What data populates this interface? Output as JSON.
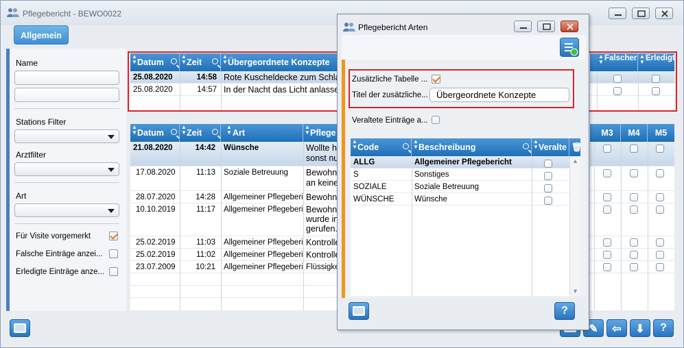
{
  "window": {
    "title": "Pflegebericht - BEWO0022"
  },
  "tabs": {
    "main": "Allgemein"
  },
  "filters": {
    "name_label": "Name",
    "stations_label": "Stations Filter",
    "arzt_label": "Arztfilter",
    "art_label": "Art",
    "visite_label": "Für Visite vorgemerkt",
    "visite_checked": true,
    "falsche_label": "Falsche Einträge anzei...",
    "erledigte_label": "Erledigte Einträge anze..."
  },
  "top_grid": {
    "headers": [
      "Datum",
      "Zeit",
      "Übergeordnete Konzepte",
      "Falscher Eintrag",
      "Erledigt Eintrag"
    ],
    "rows": [
      {
        "datum": "25.08.2020",
        "zeit": "14:58",
        "konzept": "Rote Kuscheldecke zum Schlafen",
        "bold": true
      },
      {
        "datum": "25.08.2020",
        "zeit": "14:57",
        "konzept": "In der Nacht das Licht anlassen",
        "bold": false
      }
    ]
  },
  "main_grid": {
    "headers": [
      "Datum",
      "Zeit",
      "Art",
      "Pflege",
      "M3",
      "M4",
      "M5"
    ],
    "rows": [
      {
        "datum": "21.08.2020",
        "zeit": "14:42",
        "art": "Wünsche",
        "pflege_lines": [
          "Wollte h",
          "sonst nu"
        ],
        "bold": true
      },
      {
        "datum": "17.08.2020",
        "zeit": "11:13",
        "art": "Soziale Betreuung",
        "pflege_lines": [
          "Bewohne",
          "an keine"
        ],
        "bold": false
      },
      {
        "datum": "28.07.2020",
        "zeit": "14:28",
        "art": "Allgemeiner Pflegebericht",
        "pflege_lines": [
          "Bewohne"
        ],
        "bold": false
      },
      {
        "datum": "10.10.2019",
        "zeit": "11:17",
        "art": "Allgemeiner Pflegebericht",
        "pflege_lines": [
          "Bewohne",
          "wurde in",
          "gerufen."
        ],
        "bold": false
      },
      {
        "datum": "25.02.2019",
        "zeit": "11:03",
        "art": "Allgemeiner Pflegebericht",
        "pflege_lines": [
          "Kontrolle"
        ],
        "bold": false
      },
      {
        "datum": "25.02.2019",
        "zeit": "11:02",
        "art": "Allgemeiner Pflegebericht",
        "pflege_lines": [
          "Kontrolle"
        ],
        "bold": false
      },
      {
        "datum": "23.07.2009",
        "zeit": "10:21",
        "art": "Allgemeiner Pflegebericht",
        "pflege_lines": [
          "Flüssigkeit"
        ],
        "bold": false
      }
    ]
  },
  "dialog": {
    "title": "Pflegebericht Arten",
    "zusatz_label": "Zusätzliche Tabelle ...",
    "zusatz_checked": true,
    "titel_label": "Titel der zusätzliche...",
    "titel_value": "Übergeordnete Konzepte",
    "veraltete_label": "Veraltete Einträge a...",
    "table_headers": [
      "Code",
      "Beschreibung",
      "Veralte"
    ],
    "rows": [
      {
        "code": "ALLG",
        "beschreibung": "Allgemeiner Pflegebericht",
        "bold": true
      },
      {
        "code": "S",
        "beschreibung": "Sonstiges",
        "bold": false
      },
      {
        "code": "SOZIALE",
        "beschreibung": "Soziale Betreuung",
        "bold": false
      },
      {
        "code": "WÜNSCHE",
        "beschreibung": "Wünsche",
        "bold": false
      }
    ],
    "help": "?"
  },
  "bottom": {
    "help": "?"
  },
  "colors": {
    "header_blue": "#1e6fb7",
    "accent_orange": "#f0961c",
    "highlight_red": "#d8242b"
  }
}
